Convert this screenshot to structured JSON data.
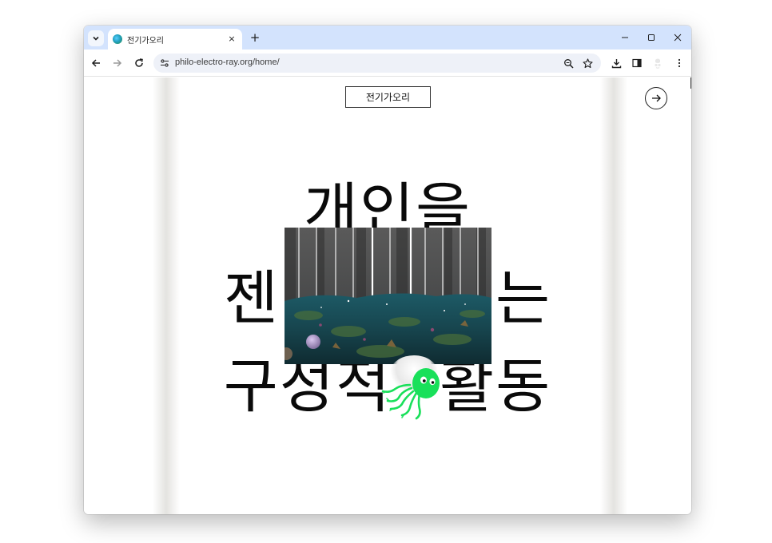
{
  "browser": {
    "tab_title": "전기가오리",
    "tab_close_glyph": "×",
    "new_tab_glyph": "+",
    "url": "philo-electro-ray.org/home/"
  },
  "page": {
    "brand_label": "전기가오리",
    "headline": {
      "line1": "개인을",
      "line2_left": "젠",
      "line2_right": "는",
      "line3_left": "구성",
      "line3_mid": "적",
      "line3_right": "활동"
    },
    "colors": {
      "accent_green": "#19e05a",
      "tabbar": "#d3e3fd",
      "omnibox": "#eef1f8"
    }
  }
}
